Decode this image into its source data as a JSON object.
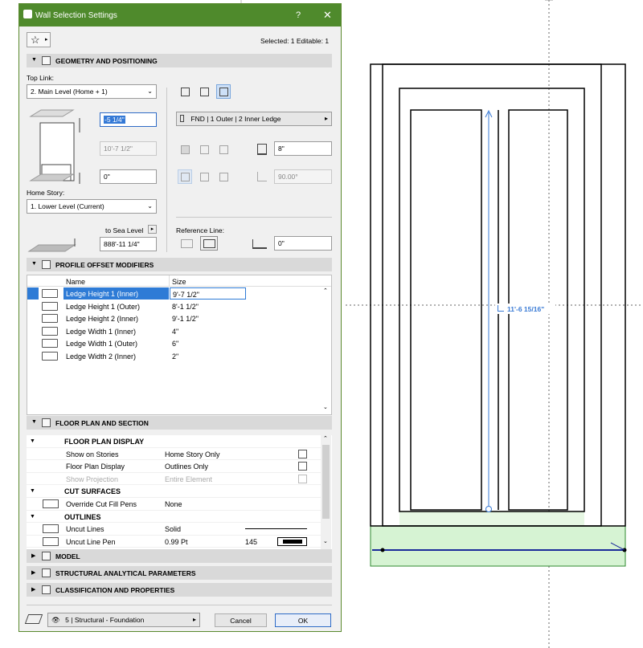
{
  "dialog": {
    "title": "Wall Selection Settings",
    "help": "?",
    "close": "✕",
    "selected_info": "Selected: 1 Editable: 1"
  },
  "geometry": {
    "header": "GEOMETRY AND POSITIONING",
    "top_link_label": "Top Link:",
    "top_link_value": "2. Main Level (Home + 1)",
    "top_offset": "-5 1/4\"",
    "height": "10'-7 1/2\"",
    "bottom_offset": "0\"",
    "home_story_label": "Home Story:",
    "home_story_value": "1. Lower Level (Current)",
    "sea_level_label": "to Sea Level",
    "sea_level_value": "888'-11 1/4\"",
    "profile_value": "FND | 1 Outer | 2 Inner Ledge",
    "thickness": "8\"",
    "angle": "90.00°",
    "reference_line_label": "Reference Line:",
    "ref_offset": "0\""
  },
  "profile_modifiers": {
    "header": "PROFILE OFFSET MODIFIERS",
    "col_name": "Name",
    "col_size": "Size",
    "rows": [
      {
        "name": "Ledge Height 1 (Inner)",
        "size": "9'-7 1/2\""
      },
      {
        "name": "Ledge Height 1 (Outer)",
        "size": "8'-1 1/2\""
      },
      {
        "name": "Ledge Height 2 (Inner)",
        "size": "9'-1 1/2\""
      },
      {
        "name": "Ledge Width 1 (Inner)",
        "size": "4\""
      },
      {
        "name": "Ledge Width 1 (Outer)",
        "size": "6\""
      },
      {
        "name": "Ledge Width 2 (Inner)",
        "size": "2\""
      }
    ],
    "selected_index": 0
  },
  "floor_plan": {
    "header": "FLOOR PLAN AND SECTION",
    "rows": [
      {
        "type": "hdr",
        "name": "FLOOR PLAN DISPLAY",
        "value": ""
      },
      {
        "type": "item",
        "name": "Show on Stories",
        "value": "Home Story Only"
      },
      {
        "type": "item",
        "name": "Floor Plan Display",
        "value": "Outlines Only"
      },
      {
        "type": "dis",
        "name": "Show Projection",
        "value": "Entire Element"
      },
      {
        "type": "hdr",
        "name": "CUT SURFACES",
        "value": ""
      },
      {
        "type": "item",
        "name": "Override Cut Fill Pens",
        "value": "None"
      },
      {
        "type": "hdr",
        "name": "OUTLINES",
        "value": ""
      },
      {
        "type": "item",
        "name": "Uncut Lines",
        "value": "Solid"
      },
      {
        "type": "item",
        "name": "Uncut Line Pen",
        "value": "0.99 Pt",
        "extra": "145"
      }
    ]
  },
  "sections": {
    "model": "MODEL",
    "structural": "STRUCTURAL ANALYTICAL PARAMETERS",
    "classification": "CLASSIFICATION AND PROPERTIES"
  },
  "footer": {
    "layer": "5 | Structural - Foundation",
    "cancel": "Cancel",
    "ok": "OK"
  },
  "canvas": {
    "dimension_label": "11'-6 15/16\""
  },
  "colors": {
    "title_bar": "#4f8a2c",
    "accent": "#2e7bd6",
    "dimension": "#3a7bd5",
    "footing_fill": "#d6f3d3"
  }
}
